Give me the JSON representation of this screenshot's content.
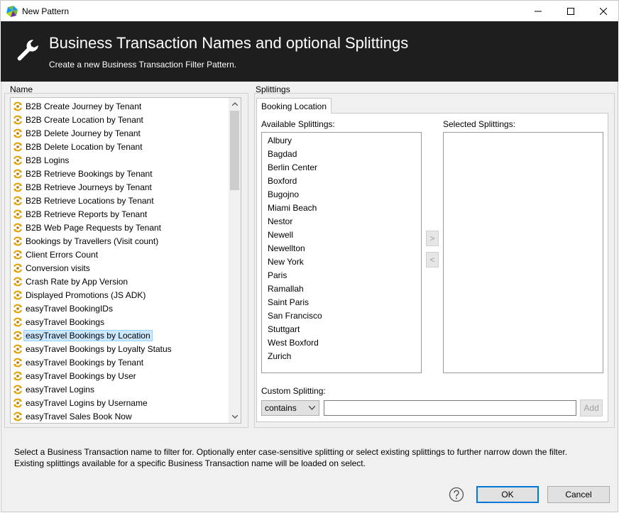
{
  "window": {
    "title": "New Pattern"
  },
  "banner": {
    "title": "Business Transaction Names and optional Splittings",
    "subtitle": "Create a new Business Transaction Filter Pattern."
  },
  "name_group": {
    "label": "Name",
    "items": [
      "B2B Create Journey by Tenant",
      "B2B Create Location by Tenant",
      "B2B Delete Journey by Tenant",
      "B2B Delete Location by Tenant",
      "B2B Logins",
      "B2B Retrieve Bookings by Tenant",
      "B2B Retrieve Journeys by Tenant",
      "B2B Retrieve Locations by Tenant",
      "B2B Retrieve Reports by Tenant",
      "B2B Web Page Requests by Tenant",
      "Bookings by Travellers (Visit count)",
      "Client Errors Count",
      "Conversion visits",
      "Crash Rate by App Version",
      "Displayed Promotions (JS ADK)",
      "easyTravel BookingIDs",
      "easyTravel Bookings",
      "easyTravel Bookings by Location",
      "easyTravel Bookings by Loyalty Status",
      "easyTravel Bookings by Tenant",
      "easyTravel Bookings by User",
      "easyTravel Logins",
      "easyTravel Logins by Username",
      "easyTravel Sales Book Now"
    ],
    "selected_item": "easyTravel Bookings by Location"
  },
  "splittings": {
    "label": "Splittings",
    "tab_label": "Booking Location",
    "available_label": "Available Splittings:",
    "selected_label": "Selected Splittings:",
    "available": [
      "Albury",
      "Bagdad",
      "Berlin Center",
      "Boxford",
      "Bugojno",
      "Miami Beach",
      "Nestor",
      "Newell",
      "Newellton",
      "New York",
      "Paris",
      "Ramallah",
      "Saint Paris",
      "San Francisco",
      "Stuttgart",
      "West Boxford",
      "Zurich"
    ],
    "selected": [],
    "move_right_label": ">",
    "move_left_label": "<",
    "custom_label": "Custom Splitting:",
    "operator_value": "contains",
    "custom_value": "",
    "add_label": "Add"
  },
  "hint": {
    "line1": "Select a Business Transaction name to filter for. Optionally enter case-sensitive splitting or select existing splittings to further narrow down the filter.",
    "line2": "Existing splittings available for a specific Business Transaction name will be loaded on select."
  },
  "buttons": {
    "ok": "OK",
    "cancel": "Cancel"
  }
}
